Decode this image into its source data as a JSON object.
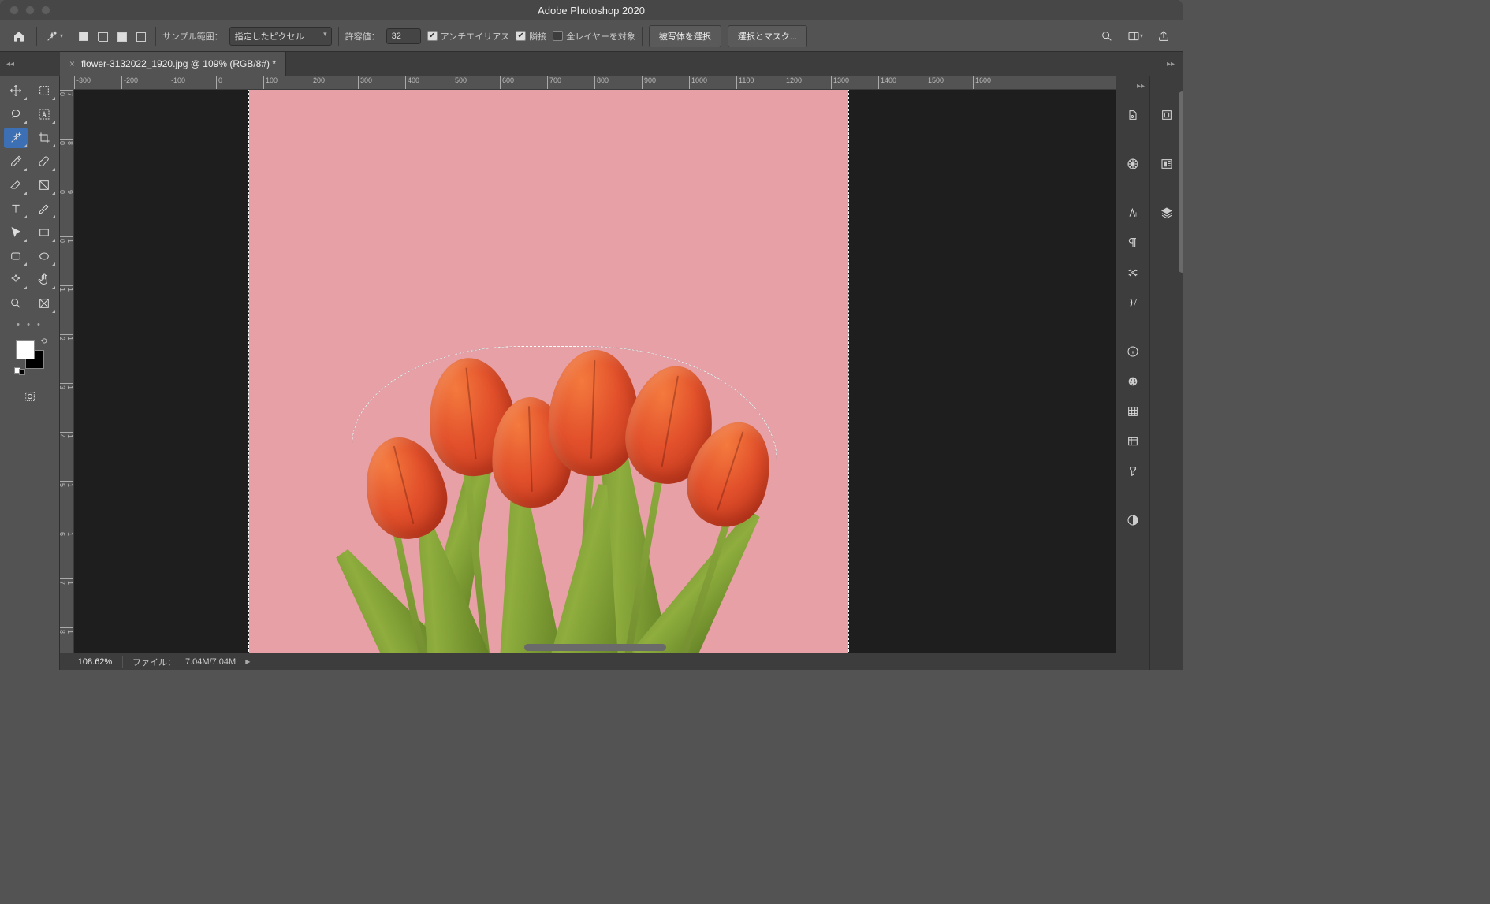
{
  "app": {
    "title": "Adobe Photoshop 2020"
  },
  "tab": {
    "label": "flower-3132022_1920.jpg @ 109% (RGB/8#) *"
  },
  "options": {
    "sample_label": "サンプル範囲：",
    "sample_value": "指定したピクセル",
    "tolerance_label": "許容値：",
    "tolerance_value": "32",
    "antialias": {
      "label": "アンチエイリアス",
      "checked": true
    },
    "contiguous": {
      "label": "隣接",
      "checked": true
    },
    "all_layers": {
      "label": "全レイヤーを対象",
      "checked": false
    },
    "select_subject": "被写体を選択",
    "select_and_mask": "選択とマスク..."
  },
  "status": {
    "zoom": "108.62%",
    "file_label": "ファイル：",
    "file_value": "7.04M/7.04M"
  },
  "ruler_h": [
    "-300",
    "-200",
    "-100",
    "0",
    "100",
    "200",
    "300",
    "400",
    "500",
    "600",
    "700",
    "800",
    "900",
    "1000",
    "1100",
    "1200",
    "1300",
    "1400",
    "1500",
    "1600"
  ],
  "ruler_v": [
    "700",
    "800",
    "900",
    "1000",
    "1100",
    "1200",
    "1300",
    "1400",
    "1500",
    "1600",
    "1700",
    "1800"
  ]
}
